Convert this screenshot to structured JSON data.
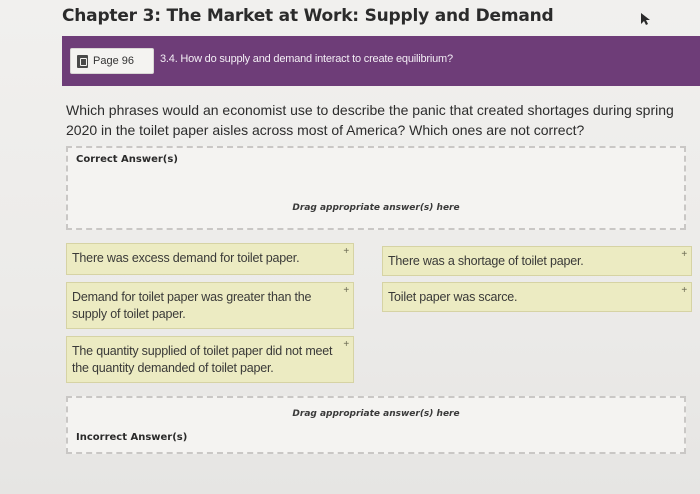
{
  "header": {
    "title": "Chapter 3: The Market at Work: Supply and Demand"
  },
  "banner": {
    "page_label": "Page 96",
    "section_label": "3.4. How do supply and demand interact to create equilibrium?"
  },
  "question": {
    "text": "Which phrases would an economist use to describe the panic that created shortages during spring 2020 in the toilet paper aisles across most of America? Which ones are not correct?"
  },
  "zones": {
    "correct": {
      "label": "Correct Answer(s)",
      "hint": "Drag appropriate answer(s) here"
    },
    "incorrect": {
      "label": "Incorrect Answer(s)",
      "hint": "Drag appropriate answer(s) here"
    }
  },
  "answers": [
    {
      "text": "There was excess demand for toilet paper."
    },
    {
      "text": "There was a shortage of toilet paper."
    },
    {
      "text": "Demand for toilet paper was greater than the supply of toilet paper."
    },
    {
      "text": "Toilet paper was scarce."
    },
    {
      "text": "The quantity supplied of toilet paper did not meet the quantity demanded of toilet paper."
    }
  ],
  "icons": {
    "card_plus": "+"
  },
  "colors": {
    "banner": "#6e3d78",
    "card": "#ecebc2"
  }
}
